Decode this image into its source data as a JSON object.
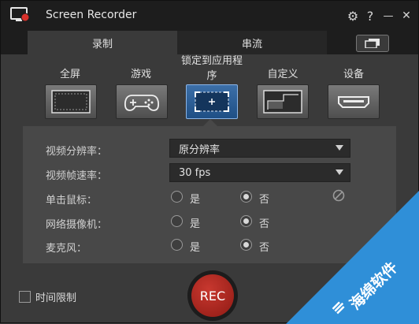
{
  "window": {
    "title": "Screen Recorder",
    "settings_glyph": "⚙",
    "help_glyph": "?",
    "minimize_glyph": "—",
    "close_glyph": "✕"
  },
  "tabs": [
    {
      "label": "录制",
      "active": true
    },
    {
      "label": "串流",
      "active": false
    }
  ],
  "modes": [
    {
      "label": "全屏",
      "icon": "fullscreen-icon"
    },
    {
      "label": "游戏",
      "icon": "gamepad-icon"
    },
    {
      "label_line1": "锁定到应用程",
      "label_line2": "序",
      "icon": "lock-app-window-icon",
      "selected": true
    },
    {
      "label": "自定义",
      "icon": "custom-region-icon"
    },
    {
      "label": "设备",
      "icon": "hdmi-device-icon"
    }
  ],
  "settings": {
    "resolution": {
      "label": "视频分辨率：",
      "value": "原分辨率"
    },
    "framerate": {
      "label": "视频帧速率：",
      "value": "30 fps"
    },
    "mouse_click": {
      "label": "单击鼠标：",
      "yes": "是",
      "no": "否",
      "selected": "no"
    },
    "webcam": {
      "label": "网络摄像机：",
      "yes": "是",
      "no": "否",
      "selected": "no"
    },
    "microphone": {
      "label": "麦克风：",
      "yes": "是",
      "no": "否",
      "selected": "no"
    }
  },
  "bottom": {
    "time_limit_label": "时间限制",
    "time_limit_checked": false,
    "rec_label": "REC"
  },
  "watermark": {
    "text": "海绵软件"
  },
  "colors": {
    "rec_red": "#b52a22",
    "selected_blue": "#2e5f99",
    "titlebar": "#1d1d1d",
    "panel": "#484848"
  }
}
